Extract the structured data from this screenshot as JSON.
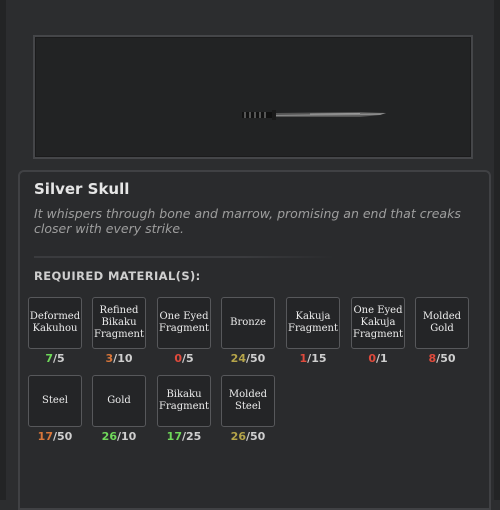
{
  "item": {
    "name": "Silver Skull",
    "description": "It whispers through bone and marrow, promising an end that creaks closer with every strike."
  },
  "preview": {
    "icon": "katana-icon"
  },
  "materials_label": "REQUIRED MATERIAL(S):",
  "materials": [
    {
      "name": "Deformed Kakuhou",
      "have": "7",
      "need": "5",
      "color": "green"
    },
    {
      "name": "Refined Bikaku Fragment",
      "have": "3",
      "need": "10",
      "color": "orange"
    },
    {
      "name": "One Eyed Fragment",
      "have": "0",
      "need": "5",
      "color": "red"
    },
    {
      "name": "Bronze",
      "have": "24",
      "need": "50",
      "color": "olive"
    },
    {
      "name": "Kakuja Fragment",
      "have": "1",
      "need": "15",
      "color": "red"
    },
    {
      "name": "One Eyed Kakuja Fragment",
      "have": "0",
      "need": "1",
      "color": "red"
    },
    {
      "name": "Molded Gold",
      "have": "8",
      "need": "50",
      "color": "red"
    },
    {
      "name": "Steel",
      "have": "17",
      "need": "50",
      "color": "orange"
    },
    {
      "name": "Gold",
      "have": "26",
      "need": "10",
      "color": "green"
    },
    {
      "name": "Bikaku Fragment",
      "have": "17",
      "need": "25",
      "color": "green"
    },
    {
      "name": "Molded Steel",
      "have": "26",
      "need": "50",
      "color": "olive"
    }
  ],
  "colors": {
    "green": "#6fd85a",
    "orange": "#d8763a",
    "red": "#e04a3c",
    "olive": "#b5a449"
  }
}
